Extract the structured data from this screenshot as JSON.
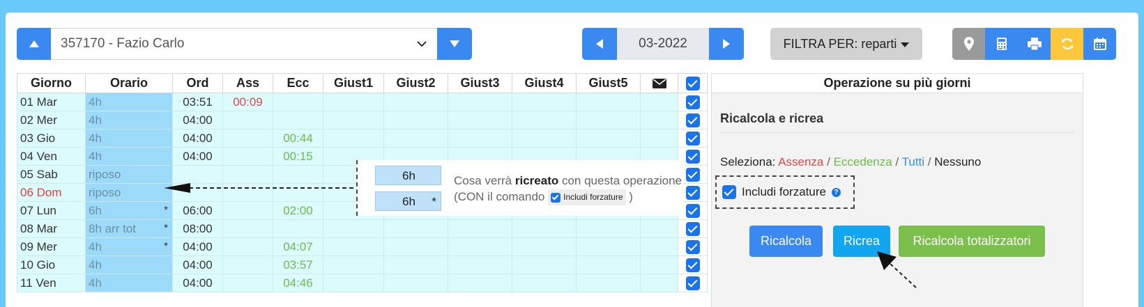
{
  "employee": {
    "selected": "357170 - Fazio Carlo"
  },
  "month": {
    "value": "03-2022"
  },
  "filter": {
    "label": "FILTRA PER: reparti"
  },
  "toolbar_icons": [
    "map-marker-icon",
    "calculator-icon",
    "print-icon",
    "sync-icon",
    "calendar-icon"
  ],
  "table": {
    "headers": [
      "Giorno",
      "Orario",
      "Ord",
      "Ass",
      "Ecc",
      "Giust1",
      "Giust2",
      "Giust3",
      "Giust4",
      "Giust5"
    ],
    "rows": [
      {
        "day": "01 Mar",
        "orario": "4h",
        "star": "",
        "ord": "03:51",
        "ass": "00:09",
        "ecc": "",
        "weekend": false
      },
      {
        "day": "02 Mer",
        "orario": "4h",
        "star": "",
        "ord": "04:00",
        "ass": "",
        "ecc": "",
        "weekend": false
      },
      {
        "day": "03 Gio",
        "orario": "4h",
        "star": "",
        "ord": "04:00",
        "ass": "",
        "ecc": "00:44",
        "weekend": false
      },
      {
        "day": "04 Ven",
        "orario": "4h",
        "star": "",
        "ord": "04:00",
        "ass": "",
        "ecc": "00:15",
        "weekend": false
      },
      {
        "day": "05 Sab",
        "orario": "riposo",
        "star": "",
        "ord": "",
        "ass": "",
        "ecc": "",
        "weekend": false
      },
      {
        "day": "06 Dom",
        "orario": "riposo",
        "star": "",
        "ord": "",
        "ass": "",
        "ecc": "",
        "weekend": true
      },
      {
        "day": "07 Lun",
        "orario": "6h",
        "star": "*",
        "ord": "06:00",
        "ass": "",
        "ecc": "02:00",
        "weekend": false
      },
      {
        "day": "08 Mar",
        "orario": "8h arr tot",
        "star": "*",
        "ord": "08:00",
        "ass": "",
        "ecc": "",
        "weekend": false
      },
      {
        "day": "09 Mer",
        "orario": "4h",
        "star": "*",
        "ord": "04:00",
        "ass": "",
        "ecc": "04:07",
        "weekend": false
      },
      {
        "day": "10 Gio",
        "orario": "4h",
        "star": "",
        "ord": "04:00",
        "ass": "",
        "ecc": "03:57",
        "weekend": false
      },
      {
        "day": "11 Ven",
        "orario": "4h",
        "star": "",
        "ord": "04:00",
        "ass": "",
        "ecc": "04:46",
        "weekend": false
      }
    ]
  },
  "panel": {
    "header": "Operazione su più giorni",
    "title": "Ricalcola e ricrea",
    "select_label": "Seleziona:",
    "select_assenza": "Assenza",
    "select_eccedenza": "Eccedenza",
    "select_tutti": "Tutti",
    "select_nessuno": "Nessuno",
    "sep": "/",
    "forzature_label": "Includi forzature",
    "help": "?",
    "btn_ricalcola": "Ricalcola",
    "btn_ricrea": "Ricrea",
    "btn_totalizzatori": "Ricalcola totalizzatori"
  },
  "legend": {
    "box1": "6h",
    "box2": "6h",
    "box2_star": "*",
    "line1_pre": "Cosa verrà ",
    "line1_bold": "ricreato",
    "line1_post": " con questa operazione",
    "line2_pre": "(CON il comando ",
    "line2_mini": "Includi forzature",
    "line2_post": " )"
  },
  "colors": {
    "background": "#69c9fb",
    "primary": "#3a89f0",
    "warning": "#fdc73c",
    "success": "#7ac04b",
    "info": "#12a6f0",
    "danger": "#e04848"
  }
}
